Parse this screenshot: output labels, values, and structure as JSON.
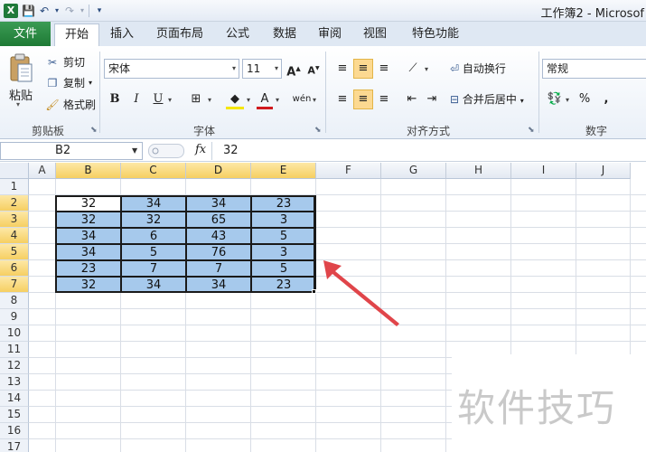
{
  "window": {
    "title": "工作簿2 - Microsof"
  },
  "tabs": {
    "file": "文件",
    "items": [
      "开始",
      "插入",
      "页面布局",
      "公式",
      "数据",
      "审阅",
      "视图",
      "特色功能"
    ]
  },
  "ribbon": {
    "clipboard": {
      "paste": "粘贴",
      "cut": "剪切",
      "copy": "复制",
      "format_painter": "格式刷",
      "label": "剪贴板"
    },
    "font": {
      "name": "宋体",
      "size": "11",
      "label": "字体"
    },
    "alignment": {
      "wrap": "自动换行",
      "merge": "合并后居中",
      "label": "对齐方式"
    },
    "number": {
      "format": "常规",
      "percent": "%",
      "comma": ",",
      "label": "数字"
    }
  },
  "formula_bar": {
    "name_box": "B2",
    "fx": "fx",
    "value": "32"
  },
  "sheet": {
    "columns": [
      "A",
      "B",
      "C",
      "D",
      "E",
      "F",
      "G",
      "H",
      "I",
      "J"
    ],
    "rows": [
      "1",
      "2",
      "3",
      "4",
      "5",
      "6",
      "7",
      "8",
      "9",
      "10",
      "11",
      "12",
      "13",
      "14",
      "15",
      "16",
      "17"
    ],
    "data": [
      [
        "32",
        "34",
        "34",
        "23"
      ],
      [
        "32",
        "32",
        "65",
        "3"
      ],
      [
        "34",
        "6",
        "43",
        "5"
      ],
      [
        "34",
        "5",
        "76",
        "3"
      ],
      [
        "23",
        "7",
        "7",
        "5"
      ],
      [
        "32",
        "34",
        "34",
        "23"
      ]
    ]
  },
  "watermark": "软件技巧",
  "colors": {
    "selection": "#a6c9ec",
    "header_highlight": "#f6cf62",
    "arrow": "#e0454a"
  }
}
